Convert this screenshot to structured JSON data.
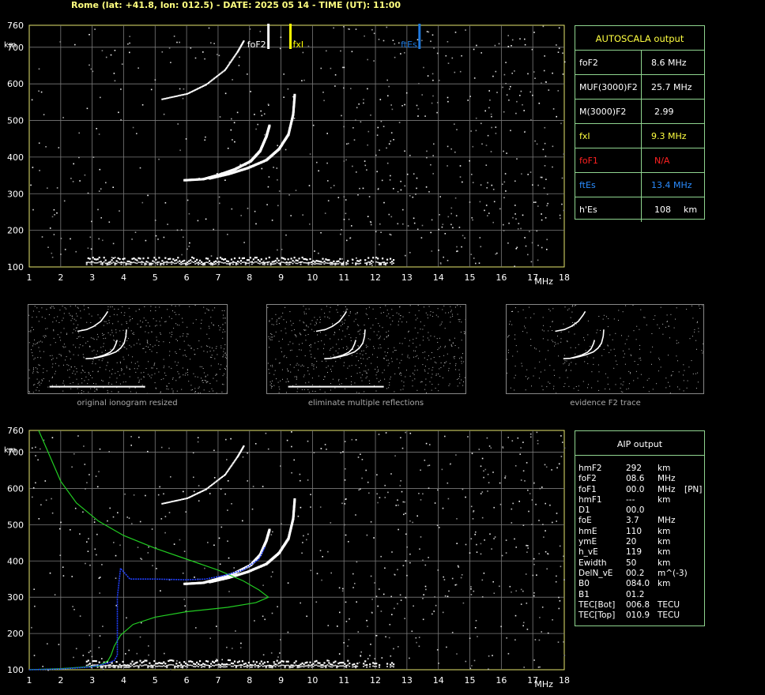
{
  "header": "Rome (lat: +41.8, lon: 012.5) - DATE: 2025 05 14 - TIME (UT): 11:00",
  "chart_data": [
    {
      "type": "scatter",
      "name": "ionogram-top",
      "xlabel": "MHz",
      "ylabel": "km",
      "xlim": [
        1,
        18
      ],
      "ylim": [
        100,
        760
      ],
      "xticks": [
        "1",
        "2",
        "3",
        "4",
        "5",
        "6",
        "7",
        "8",
        "9",
        "10",
        "11",
        "12",
        "13",
        "14",
        "15",
        "16",
        "17",
        "18"
      ],
      "yticks": [
        "100",
        "200",
        "300",
        "400",
        "500",
        "600",
        "700",
        "760"
      ],
      "grid": true,
      "markers": [
        {
          "label": "foF2",
          "x": 8.6,
          "color": "#ffffff"
        },
        {
          "label": "fxI",
          "x": 9.3,
          "color": "#ffff00"
        },
        {
          "label": "ftEs",
          "x": 13.4,
          "color": "#1e78dc"
        }
      ],
      "traces": {
        "es_layer": {
          "x_from": 2.8,
          "x_to": 12.6,
          "height": 120
        },
        "f2_ordinary": [
          [
            5.9,
            340
          ],
          [
            6.5,
            343
          ],
          [
            7.0,
            355
          ],
          [
            7.5,
            370
          ],
          [
            8.0,
            392
          ],
          [
            8.3,
            420
          ],
          [
            8.5,
            460
          ],
          [
            8.6,
            490
          ]
        ],
        "f2_extraordinary": [
          [
            6.7,
            345
          ],
          [
            7.3,
            357
          ],
          [
            7.9,
            373
          ],
          [
            8.5,
            395
          ],
          [
            8.9,
            425
          ],
          [
            9.2,
            465
          ],
          [
            9.35,
            520
          ],
          [
            9.4,
            575
          ]
        ],
        "f2_second_hop": [
          [
            5.2,
            560
          ],
          [
            6.0,
            575
          ],
          [
            6.6,
            600
          ],
          [
            7.2,
            640
          ],
          [
            7.6,
            690
          ],
          [
            7.8,
            720
          ]
        ]
      }
    },
    {
      "type": "scatter",
      "name": "ionogram-bottom",
      "xlabel": "MHz",
      "ylabel": "km",
      "xlim": [
        1,
        18
      ],
      "ylim": [
        100,
        760
      ],
      "xticks": [
        "1",
        "2",
        "3",
        "4",
        "5",
        "6",
        "7",
        "8",
        "9",
        "10",
        "11",
        "12",
        "13",
        "14",
        "15",
        "16",
        "17",
        "18"
      ],
      "yticks": [
        "100",
        "200",
        "300",
        "400",
        "500",
        "600",
        "700",
        "760"
      ],
      "grid": true,
      "profile_green": [
        [
          1.3,
          760
        ],
        [
          1.6,
          700
        ],
        [
          2.0,
          620
        ],
        [
          2.5,
          560
        ],
        [
          3.2,
          510
        ],
        [
          4.0,
          470
        ],
        [
          5.0,
          435
        ],
        [
          6.0,
          405
        ],
        [
          7.0,
          375
        ],
        [
          7.8,
          345
        ],
        [
          8.3,
          320
        ],
        [
          8.6,
          300
        ],
        [
          8.2,
          285
        ],
        [
          7.3,
          272
        ],
        [
          6.0,
          260
        ],
        [
          5.0,
          245
        ],
        [
          4.3,
          225
        ],
        [
          3.9,
          195
        ],
        [
          3.7,
          165
        ],
        [
          3.6,
          140
        ],
        [
          3.5,
          125
        ],
        [
          3.2,
          110
        ],
        [
          2.0,
          103
        ],
        [
          1.0,
          100
        ]
      ],
      "profile_blue": [
        [
          1.0,
          100
        ],
        [
          2.0,
          102
        ],
        [
          3.0,
          108
        ],
        [
          3.5,
          118
        ],
        [
          3.7,
          125
        ],
        [
          3.8,
          140
        ],
        [
          3.8,
          300
        ],
        [
          3.9,
          380
        ],
        [
          4.2,
          350
        ],
        [
          5.0,
          350
        ],
        [
          6.0,
          348
        ],
        [
          6.6,
          350
        ],
        [
          7.2,
          360
        ],
        [
          7.8,
          375
        ],
        [
          8.3,
          405
        ],
        [
          8.5,
          440
        ]
      ]
    }
  ],
  "autoscala": {
    "title": "AUTOSCALA output",
    "rows": [
      {
        "label": "foF2",
        "value": "8.6 MHz",
        "color": "#ffffff"
      },
      {
        "label": "MUF(3000)F2",
        "value": "25.7 MHz",
        "color": "#ffffff"
      },
      {
        "label": "M(3000)F2",
        "value": "2.99",
        "color": "#ffffff"
      },
      {
        "label": "fxI",
        "value": "9.3 MHz",
        "color": "#ffff40"
      },
      {
        "label": "foF1",
        "value": "N/A",
        "color": "#ff2020"
      },
      {
        "label": "ftEs",
        "value": "13.4 MHz",
        "color": "#2a8cff"
      },
      {
        "label": "h'Es",
        "value": "108",
        "unit": "km",
        "color": "#ffffff"
      }
    ]
  },
  "aip": {
    "title": "AIP output",
    "rows": [
      {
        "name": "hmF2",
        "value": "292",
        "unit": "km",
        "extra": ""
      },
      {
        "name": "foF2",
        "value": "08.6",
        "unit": "MHz",
        "extra": ""
      },
      {
        "name": "foF1",
        "value": "00.0",
        "unit": "MHz",
        "extra": "[PN]"
      },
      {
        "name": "hmF1",
        "value": "---",
        "unit": "km",
        "extra": ""
      },
      {
        "name": "D1",
        "value": "00.0",
        "unit": "",
        "extra": ""
      },
      {
        "name": "foE",
        "value": "3.7",
        "unit": "MHz",
        "extra": ""
      },
      {
        "name": "hmE",
        "value": "110",
        "unit": "km",
        "extra": ""
      },
      {
        "name": "ymE",
        "value": "20",
        "unit": "km",
        "extra": ""
      },
      {
        "name": "h_vE",
        "value": "119",
        "unit": "km",
        "extra": ""
      },
      {
        "name": "Ewidth",
        "value": "50",
        "unit": "km",
        "extra": ""
      },
      {
        "name": "DelN_vE",
        "value": "00.2",
        "unit": "m^(-3)",
        "extra": ""
      },
      {
        "name": "B0",
        "value": "084.0",
        "unit": "km",
        "extra": ""
      },
      {
        "name": "B1",
        "value": "01.2",
        "unit": "",
        "extra": ""
      },
      {
        "name": "TEC[Bot]",
        "value": "006.8",
        "unit": "TECU",
        "extra": ""
      },
      {
        "name": "TEC[Top]",
        "value": "010.9",
        "unit": "TECU",
        "extra": ""
      }
    ]
  },
  "thumbnails": [
    {
      "caption": "original ionogram resized"
    },
    {
      "caption": "eliminate multiple reflections"
    },
    {
      "caption": "evidence F2 trace"
    }
  ]
}
